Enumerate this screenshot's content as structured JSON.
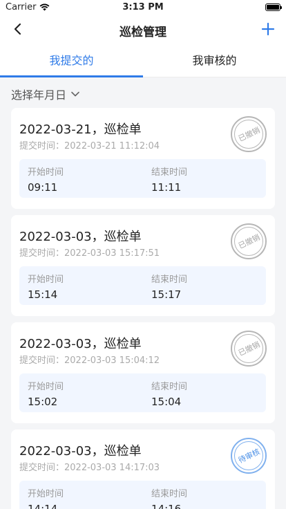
{
  "status_bar": {
    "carrier": "Carrier",
    "time": "3:13 PM"
  },
  "nav": {
    "title": "巡检管理"
  },
  "tabs": [
    {
      "label": "我提交的",
      "active": true
    },
    {
      "label": "我审核的",
      "active": false
    }
  ],
  "filter": {
    "label": "选择年月日"
  },
  "accent_color": "#2f7be8",
  "cards": [
    {
      "title": "2022-03-21，巡检单",
      "submitted": "提交时间：2022-03-21 11:12:04",
      "start_label": "开始时间",
      "start": "09:11",
      "end_label": "结束时间",
      "end": "11:11",
      "status": "已撤销"
    },
    {
      "title": "2022-03-03，巡检单",
      "submitted": "提交时间：2022-03-03 15:17:51",
      "start_label": "开始时间",
      "start": "15:14",
      "end_label": "结束时间",
      "end": "15:17",
      "status": "已撤销"
    },
    {
      "title": "2022-03-03，巡检单",
      "submitted": "提交时间：2022-03-03 15:04:12",
      "start_label": "开始时间",
      "start": "15:02",
      "end_label": "结束时间",
      "end": "15:04",
      "status": "已撤销"
    },
    {
      "title": "2022-03-03，巡检单",
      "submitted": "提交时间：2022-03-03 14:17:03",
      "start_label": "开始时间",
      "start": "14:14",
      "end_label": "结束时间",
      "end": "14:16",
      "status": "待审核"
    }
  ]
}
